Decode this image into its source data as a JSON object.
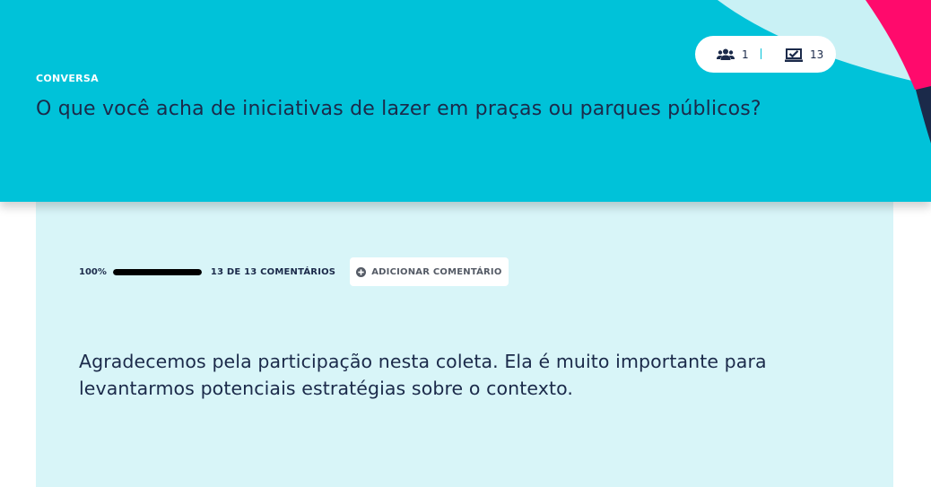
{
  "header": {
    "category": "CONVERSA",
    "title": "O que você acha de iniciativas de lazer em praças ou parques públicos?",
    "stats": {
      "participants_icon": "users-icon",
      "participants": "1",
      "divider": "|",
      "votes_icon": "vote-box-icon",
      "votes": "13"
    }
  },
  "progress": {
    "percent_label": "100%",
    "percent_value": 1.0,
    "count_label": "13 DE 13 COMENTÁRIOS"
  },
  "actions": {
    "add_comment_icon": "plus-circle-icon",
    "add_comment_label": "ADICIONAR COMENTÁRIO"
  },
  "message": "Agradecemos pela participação nesta coleta. Ela é muito importante para levantarmos potenciais estratégias sobre o contexto.",
  "colors": {
    "header_bg": "#00c2d9",
    "card_bg": "#d8f5f8",
    "accent_pink": "#ff0a6c",
    "accent_navy": "#1b2a4a",
    "text_dark": "#1b2a4a"
  }
}
